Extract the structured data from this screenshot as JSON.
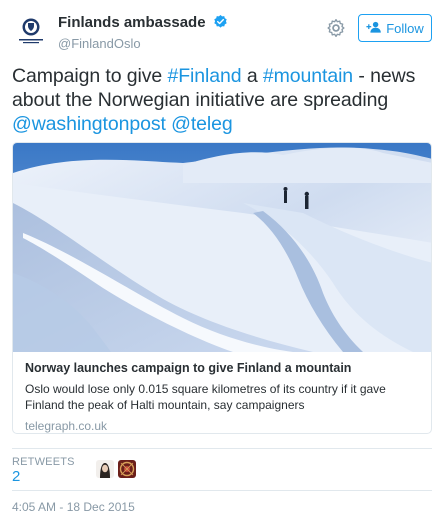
{
  "header": {
    "display_name": "Finlands ambassade",
    "handle": "@FinlandOslo",
    "follow_label": "Follow"
  },
  "tweet": {
    "parts": [
      {
        "text": "Campaign to give ",
        "link": false
      },
      {
        "text": "#Finland",
        "link": true
      },
      {
        "text": " a ",
        "link": false
      },
      {
        "text": "#mountain",
        "link": true
      },
      {
        "text": " - news about the Norwegian initiative are spreading ",
        "link": false
      },
      {
        "text": "@washingtonpost",
        "link": true
      },
      {
        "text": " ",
        "link": false
      },
      {
        "text": "@teleg",
        "link": true
      }
    ]
  },
  "card": {
    "title": "Norway launches campaign to give Finland a mountain",
    "description": "Oslo would lose only 0.015 square kilometres of its country if it gave Finland the peak of Halti mountain, say campaigners",
    "domain": "telegraph.co.uk"
  },
  "stats": {
    "retweets_label": "RETWEETS",
    "retweets_count": "2"
  },
  "timestamp": "4:05 AM - 18 Dec 2015",
  "colors": {
    "link": "#1b95e0",
    "verified": "#1da1f2",
    "muted": "#8899a6"
  }
}
